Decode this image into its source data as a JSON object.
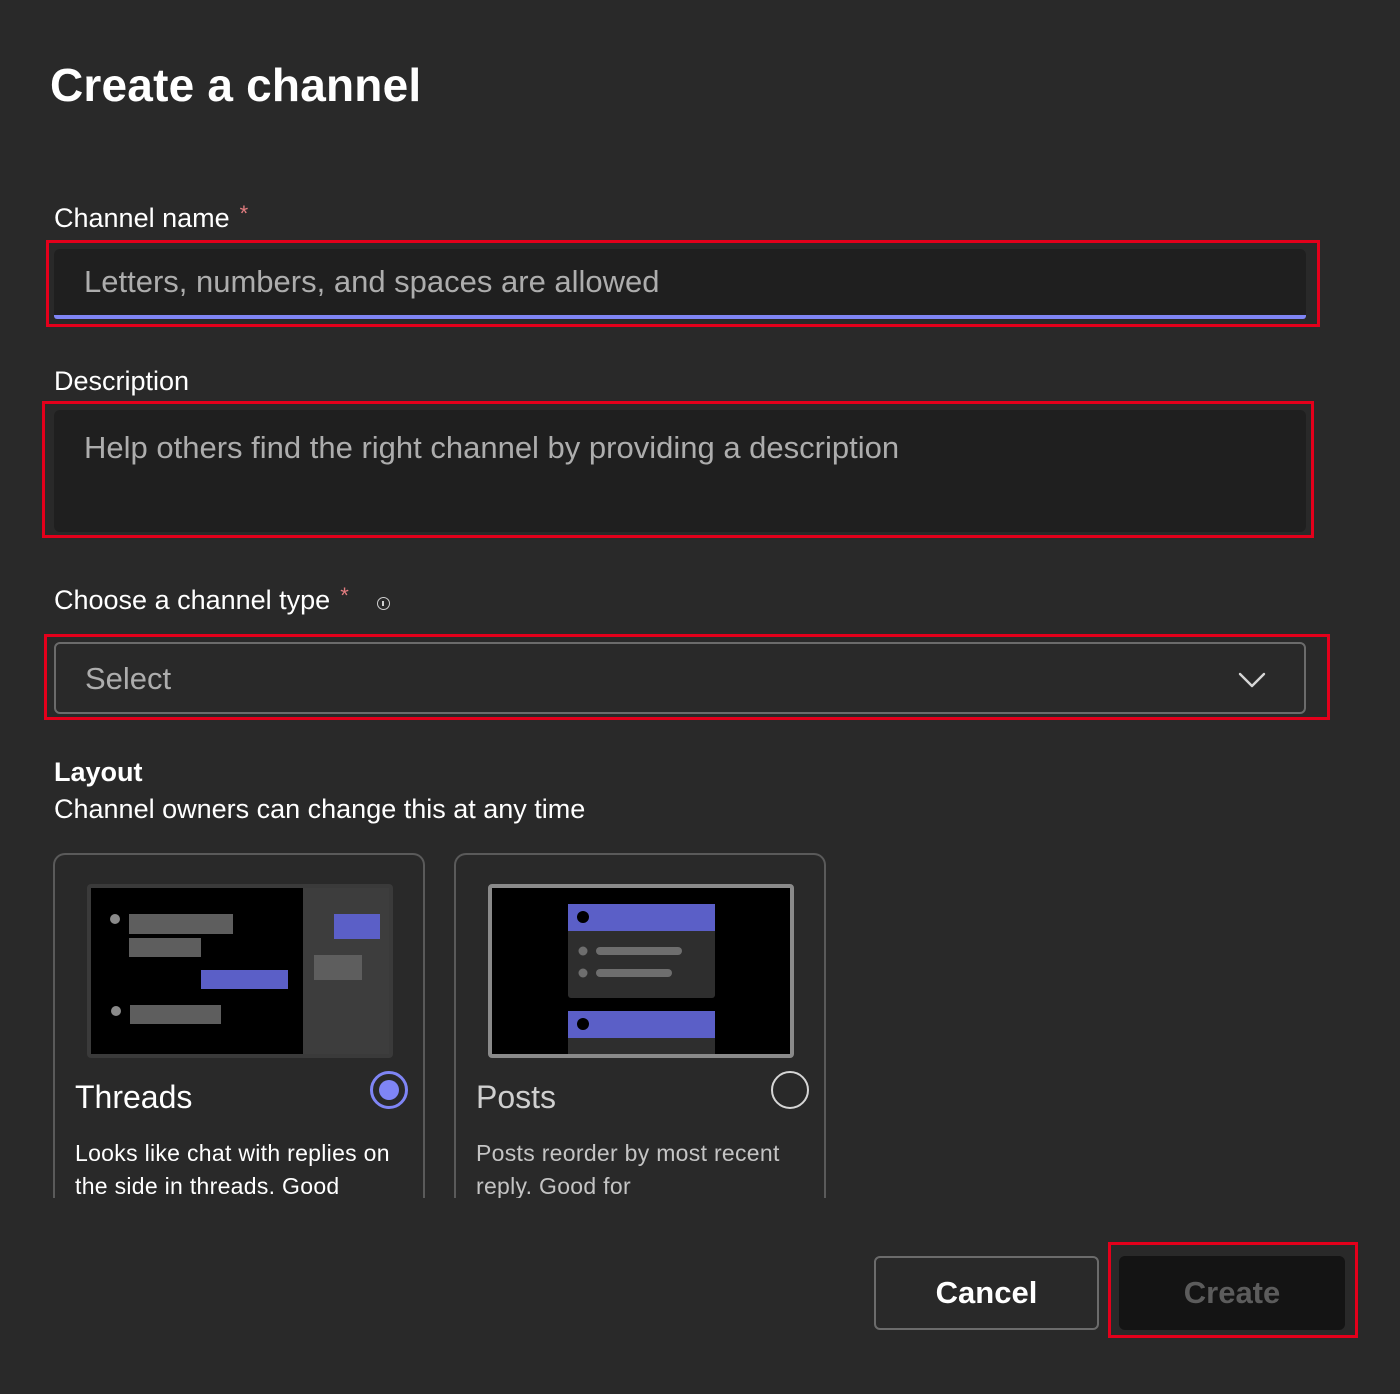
{
  "dialog": {
    "title": "Create a channel"
  },
  "channel_name": {
    "label": "Channel name",
    "required_mark": "*",
    "placeholder": "Letters, numbers, and spaces are allowed",
    "value": ""
  },
  "description": {
    "label": "Description",
    "placeholder": "Help others find the right channel by providing a description",
    "value": ""
  },
  "channel_type": {
    "label": "Choose a channel type",
    "required_mark": "*",
    "selected": "Select"
  },
  "layout": {
    "heading": "Layout",
    "subtitle": "Channel owners can change this at any time",
    "options": [
      {
        "name": "Threads",
        "description": "Looks like chat with replies on the side in threads. Good",
        "selected": true
      },
      {
        "name": "Posts",
        "description": "Posts reorder by most recent reply. Good for",
        "selected": false
      }
    ]
  },
  "buttons": {
    "cancel": "Cancel",
    "create": "Create"
  },
  "colors": {
    "background": "#292929",
    "accent": "#7f85f5",
    "field_bg": "#1f1f1f",
    "highlight": "#e3001b"
  }
}
